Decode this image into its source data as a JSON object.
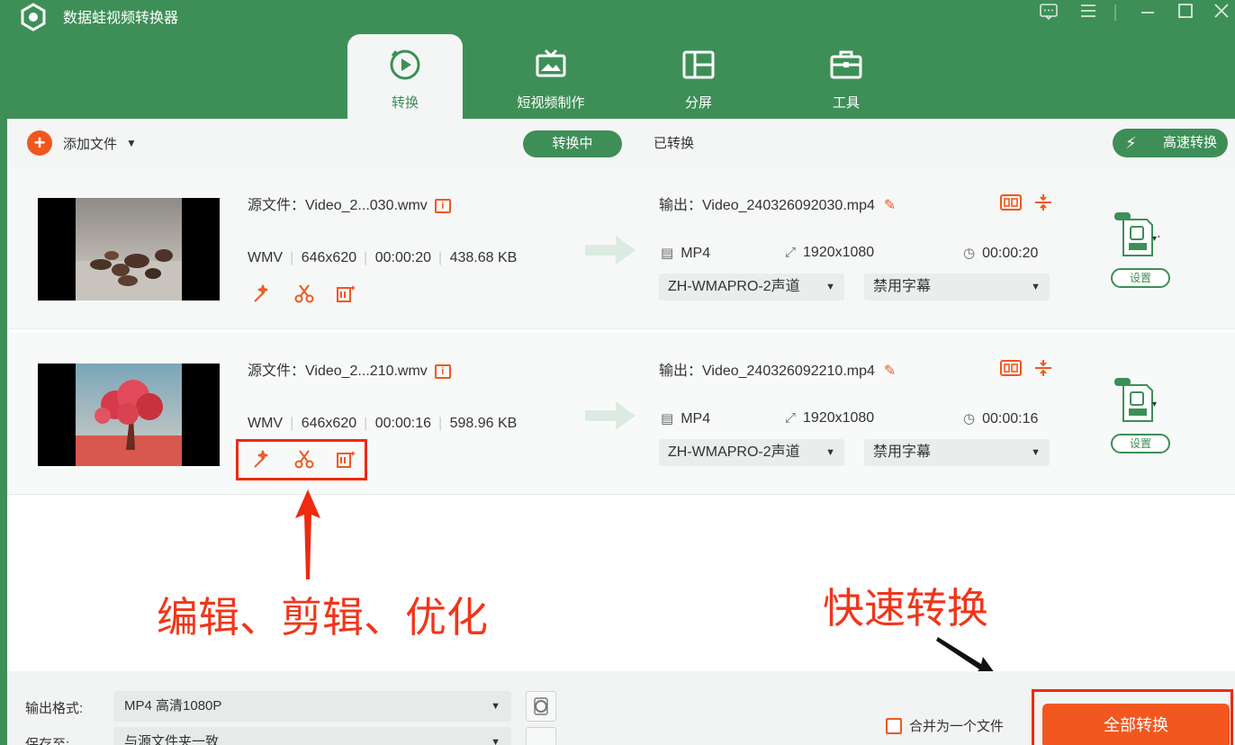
{
  "app": {
    "title": "数据蛙视频转换器"
  },
  "colors": {
    "brand_green": "#3d8f57",
    "accent_orange": "#f1571f",
    "annotation_red": "#ee2a10"
  },
  "tabs": [
    {
      "label": "转换",
      "icon": "convert-icon",
      "active": true
    },
    {
      "label": "短视频制作",
      "icon": "tv-icon",
      "active": false
    },
    {
      "label": "分屏",
      "icon": "split-screen-icon",
      "active": false
    },
    {
      "label": "工具",
      "icon": "toolbox-icon",
      "active": false
    }
  ],
  "toolbar": {
    "add_file": "添加文件",
    "seg_converting": "转换中",
    "seg_converted": "已转换",
    "turbo": "高速转换"
  },
  "files": [
    {
      "src_name": "源文件：Video_2...030.wmv",
      "format": "WMV",
      "resolution": "646x620",
      "duration": "00:00:20",
      "size": "438.68 KB",
      "out_name": "输出：Video_240326092030.mp4",
      "out_format": "MP4",
      "out_resolution": "1920x1080",
      "out_duration": "00:00:20",
      "audio": "ZH-WMAPRO-2声道",
      "subtitle": "禁用字幕",
      "settings": "设置"
    },
    {
      "src_name": "源文件：Video_2...210.wmv",
      "format": "WMV",
      "resolution": "646x620",
      "duration": "00:00:16",
      "size": "598.96 KB",
      "out_name": "输出：Video_240326092210.mp4",
      "out_format": "MP4",
      "out_resolution": "1920x1080",
      "out_duration": "00:00:16",
      "audio": "ZH-WMAPRO-2声道",
      "subtitle": "禁用字幕",
      "settings": "设置"
    }
  ],
  "annotations": {
    "tools_caption": "编辑、剪辑、优化",
    "convert_caption": "快速转换"
  },
  "bottom": {
    "format_label": "输出格式:",
    "format_value": "MP4 高清1080P",
    "save_label": "保存至:",
    "save_value": "与源文件夹一致",
    "merge": "合并为一个文件",
    "convert_all": "全部转换"
  }
}
